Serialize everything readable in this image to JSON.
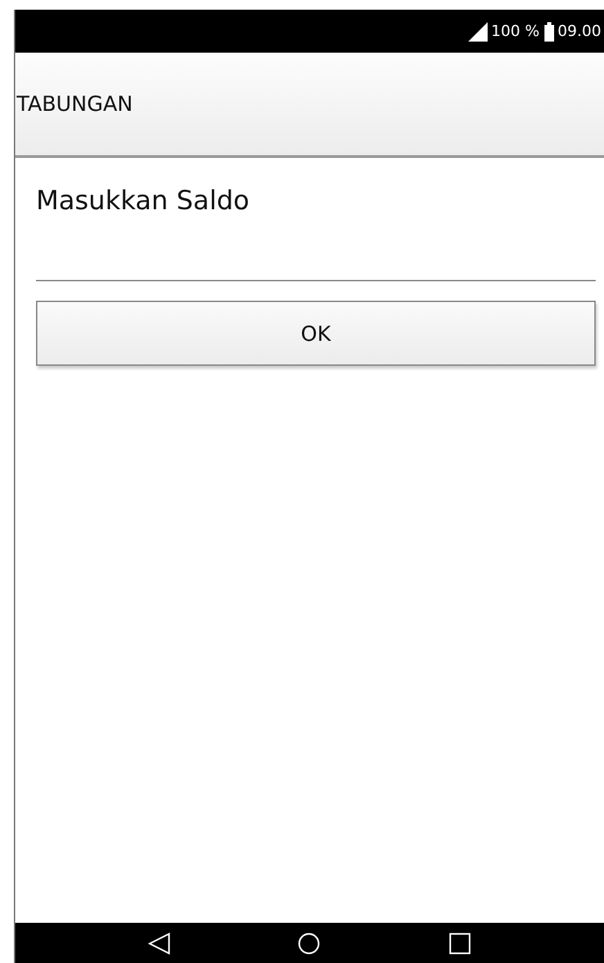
{
  "status_bar": {
    "battery": "100 %",
    "time": "09.00"
  },
  "app_bar": {
    "title": "TABUNGAN"
  },
  "form": {
    "label": "Masukkan Saldo",
    "button": "OK"
  }
}
